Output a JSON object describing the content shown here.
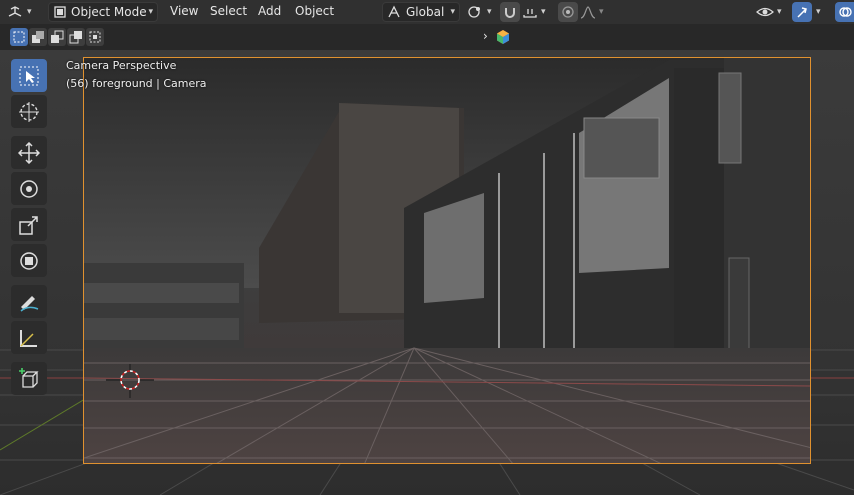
{
  "header": {
    "mode": "Object Mode",
    "menus": [
      "View",
      "Select",
      "Add",
      "Object"
    ],
    "transform_orientation": "Global"
  },
  "viewport": {
    "title": "Camera Perspective",
    "subtitle": "(56) foreground | Camera"
  },
  "toolbar": {
    "tools": [
      "select-box",
      "cursor",
      "move",
      "rotate",
      "scale",
      "transform",
      "annotate",
      "measure",
      "add-cube"
    ],
    "active_tool": "select-box"
  },
  "colors": {
    "accent": "#4772b3",
    "camera_frame": "#e0912f",
    "header_bg": "#303030"
  }
}
